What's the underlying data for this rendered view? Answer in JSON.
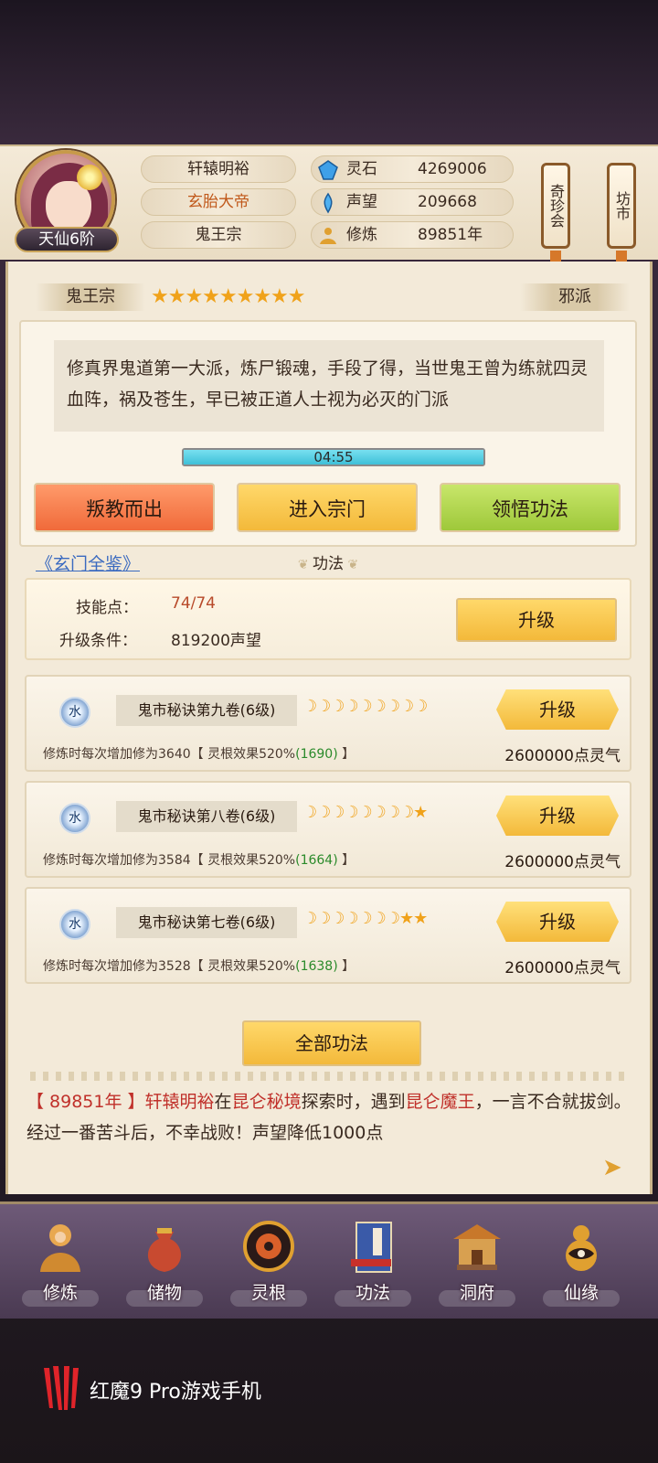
{
  "player": {
    "name": "轩辕明裕",
    "title": "玄胎大帝",
    "sect": "鬼王宗",
    "rank": "天仙6阶"
  },
  "resources": [
    {
      "icon": "spirit-stone-icon",
      "label": "灵石",
      "value": "4269006"
    },
    {
      "icon": "prestige-icon",
      "label": "声望",
      "value": "209668"
    },
    {
      "icon": "cultivation-icon",
      "label": "修炼",
      "value": "89851年"
    }
  ],
  "side_buttons": {
    "treasure": "奇珍会",
    "market": "坊市"
  },
  "sect_panel": {
    "name": "鬼王宗",
    "stars": "★★★★★★★★★",
    "type": "邪派",
    "description": "修真界鬼道第一大派，炼尸锻魂，手段了得，当世鬼王曾为练就四灵血阵，祸及苍生，早已被正道人士视为必灭的门派",
    "timer": "04:55",
    "timer_progress": 1.0,
    "buttons": {
      "leave": "叛教而出",
      "enter": "进入宗门",
      "learn": "领悟功法"
    }
  },
  "book_link": "《玄门全鉴》",
  "section_title": "功法",
  "skill_points": {
    "label_points": "技能点：",
    "points": "74/74",
    "label_condition": "升级条件：",
    "condition": "819200声望",
    "upgrade": "升级"
  },
  "techniques": [
    {
      "element": "水",
      "name": "鬼市秘诀第九卷(6级)",
      "moons": "☽☽☽☽☽☽☽☽☽",
      "button": "升级",
      "desc_prefix": "修炼时每次增加修为3640【 灵根效果520%",
      "desc_bonus": "(1690)",
      "desc_suffix": " 】",
      "cost": "2600000点灵气"
    },
    {
      "element": "水",
      "name": "鬼市秘诀第八卷(6级)",
      "moons": "☽☽☽☽☽☽☽☽★",
      "button": "升级",
      "desc_prefix": "修炼时每次增加修为3584【 灵根效果520%",
      "desc_bonus": "(1664)",
      "desc_suffix": " 】",
      "cost": "2600000点灵气"
    },
    {
      "element": "水",
      "name": "鬼市秘诀第七卷(6级)",
      "moons": "☽☽☽☽☽☽☽★★",
      "button": "升级",
      "desc_prefix": "修炼时每次增加修为3528【 灵根效果520%",
      "desc_bonus": "(1638)",
      "desc_suffix": " 】",
      "cost": "2600000点灵气"
    }
  ],
  "all_techniques": "全部功法",
  "log": {
    "year": "【 89851年 】",
    "actor": "轩辕明裕",
    "t1": "在",
    "place": "昆仑秘境",
    "t2": "探索时，遇到",
    "enemy": "昆仑魔王",
    "t3": "，一言不合就拔剑。经过一番苦斗后，不幸战败！声望降低1000点"
  },
  "nav": [
    {
      "label": "修炼",
      "icon": "meditating-monk-icon"
    },
    {
      "label": "储物",
      "icon": "treasure-bag-icon"
    },
    {
      "label": "灵根",
      "icon": "spirit-root-icon"
    },
    {
      "label": "功法",
      "icon": "scripture-book-icon"
    },
    {
      "label": "洞府",
      "icon": "cave-palace-icon"
    },
    {
      "label": "仙缘",
      "icon": "immortal-gourd-icon"
    }
  ],
  "watermark": "红魔9 Pro游戏手机"
}
